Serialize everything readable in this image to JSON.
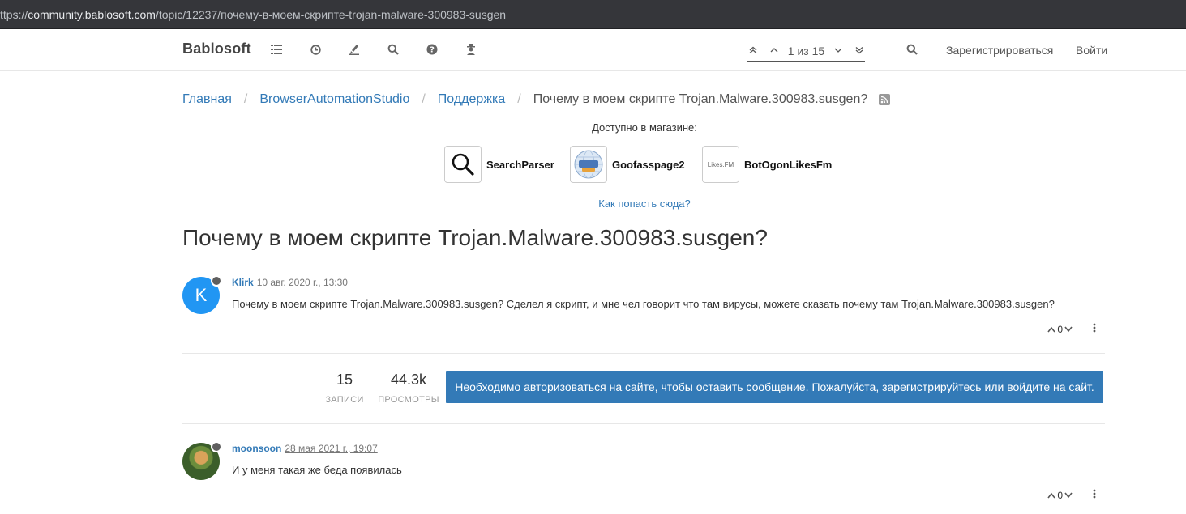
{
  "browser": {
    "url_prefix": "ttps://",
    "url_host": "community.bablosoft.com",
    "url_path": "/topic/12237/почему-в-моем-скрипте-trojan-malware-300983-susgen"
  },
  "navbar": {
    "brand": "Bablosoft",
    "icons": [
      "list-icon",
      "clock-icon",
      "fire-icon",
      "search-icon",
      "help-icon",
      "users-icon"
    ],
    "pager_text": "1 из 15",
    "register": "Зарегистрироваться",
    "login": "Войти"
  },
  "breadcrumb": {
    "home": "Главная",
    "category": "BrowserAutomationStudio",
    "subcategory": "Поддержка",
    "current": "Почему в моем скрипте Trojan.Malware.300983.susgen?"
  },
  "shop": {
    "label": "Доступно в магазине:",
    "items": [
      {
        "name": "SearchParser",
        "thumb_text": ""
      },
      {
        "name": "Goofasspage2",
        "thumb_text": ""
      },
      {
        "name": "BotOgonLikesFm",
        "thumb_text": "Likes.FM"
      }
    ],
    "howto": "Как попасть сюда?"
  },
  "topic": {
    "title": "Почему в моем скрипте Trojan.Malware.300983.susgen?"
  },
  "posts": [
    {
      "avatar_letter": "K",
      "user": "Klirk",
      "time": "10 авг. 2020 г., 13:30",
      "content": "Почему в моем скрипте Trojan.Malware.300983.susgen? Сделел я скрипт, и мне чел говорит что там вирусы, можете сказать почему там Trojan.Malware.300983.susgen?",
      "votes": "0"
    },
    {
      "avatar_letter": "",
      "user": "moonsoon",
      "time": "28 мая 2021 г., 19:07",
      "content": "И у меня такая же беда появилась",
      "votes": "0"
    }
  ],
  "stats": {
    "posts_count": "15",
    "posts_label": "ЗАПИСИ",
    "views_count": "44.3k",
    "views_label": "ПРОСМОТРЫ"
  },
  "login_prompt": "Необходимо авторизоваться на сайте, чтобы оставить сообщение. Пожалуйста, зарегистрируйтесь или войдите на сайт.",
  "colors": {
    "link": "#337ab7",
    "avatar_k": "#2196f3",
    "button": "#337ab7"
  }
}
